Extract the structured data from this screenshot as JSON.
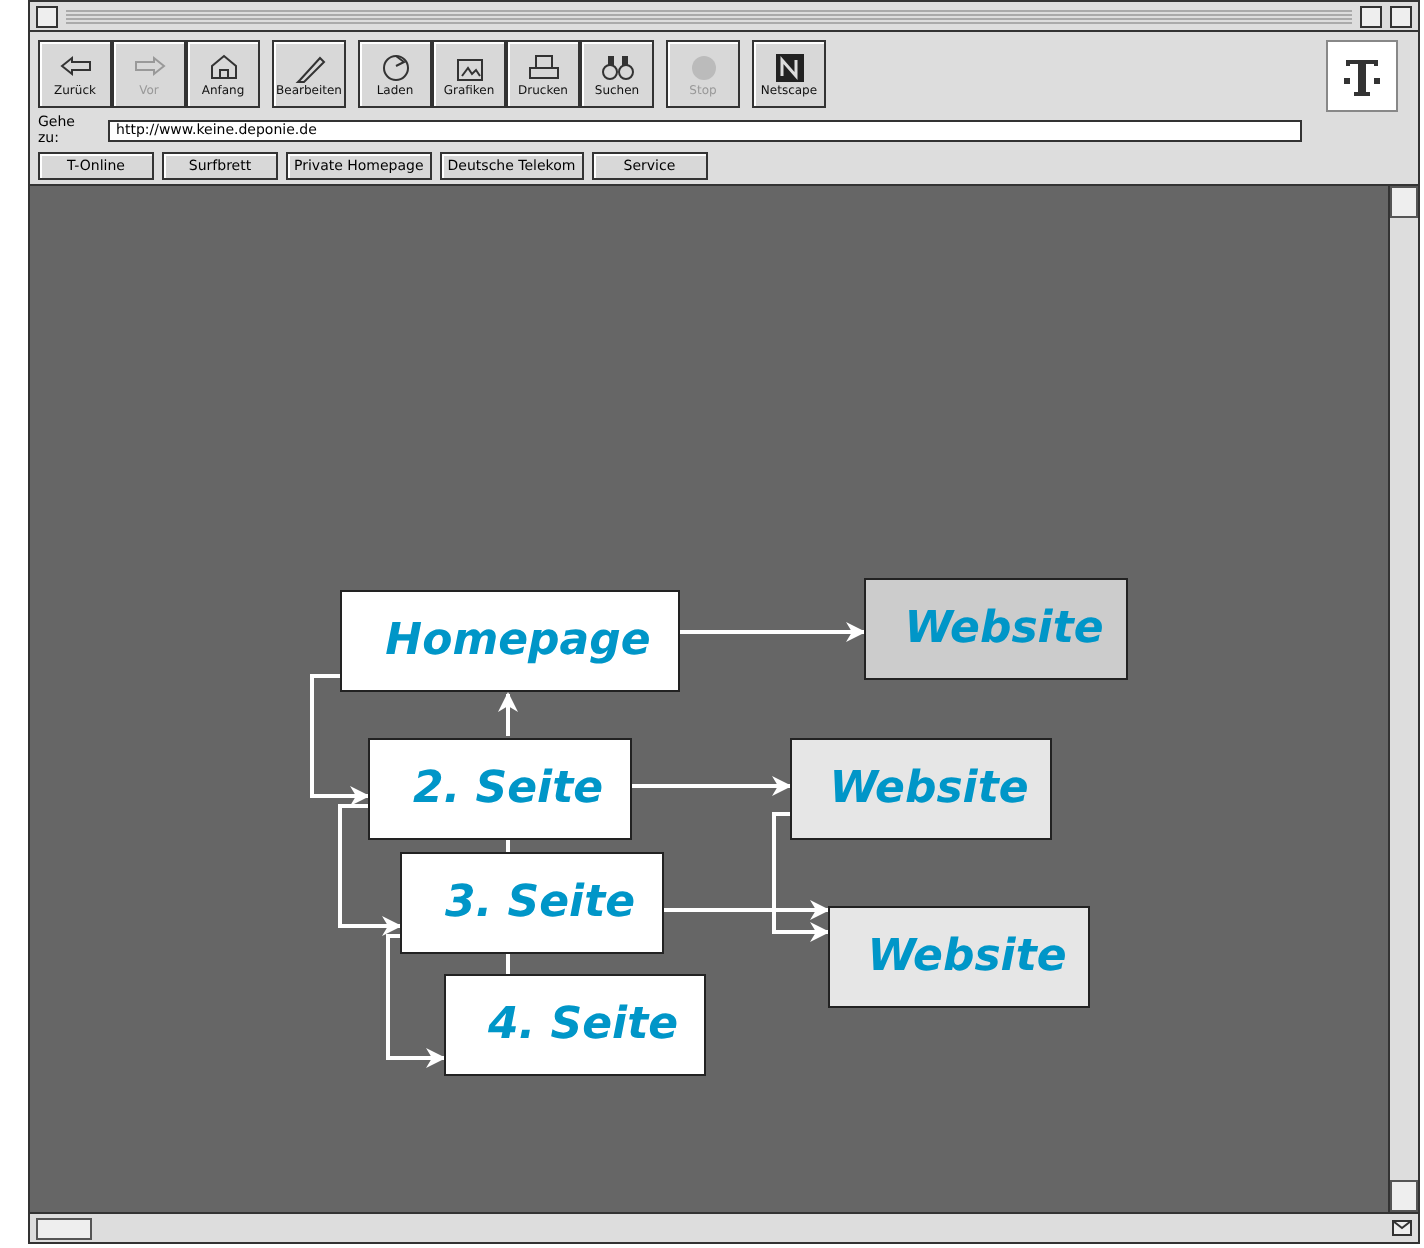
{
  "toolbar": {
    "groups": [
      [
        {
          "label": "Zurück",
          "disabled": false
        },
        {
          "label": "Vor",
          "disabled": true
        },
        {
          "label": "Anfang",
          "disabled": false
        }
      ],
      [
        {
          "label": "Bearbeiten",
          "disabled": false
        }
      ],
      [
        {
          "label": "Laden",
          "disabled": false
        },
        {
          "label": "Grafiken",
          "disabled": false
        },
        {
          "label": "Drucken",
          "disabled": false
        },
        {
          "label": "Suchen",
          "disabled": false
        }
      ],
      [
        {
          "label": "Stop",
          "disabled": true
        }
      ],
      [
        {
          "label": "Netscape",
          "disabled": false
        }
      ]
    ]
  },
  "location": {
    "label": "Gehe zu:",
    "value": "http://www.keine.deponie.de"
  },
  "directory_buttons": [
    "T-Online",
    "Surfbrett",
    "Private Homepage",
    "Deutsche Telekom",
    "Service"
  ],
  "diagram": {
    "nodes": [
      {
        "label": "Homepage",
        "kind": "page"
      },
      {
        "label": "Website",
        "kind": "website",
        "color": "#cccccc"
      },
      {
        "label": "2. Seite",
        "kind": "page"
      },
      {
        "label": "Website",
        "kind": "website",
        "color": "#e6e6e6"
      },
      {
        "label": "3. Seite",
        "kind": "page"
      },
      {
        "label": "Website",
        "kind": "website",
        "color": "#e6e6e6"
      },
      {
        "label": "4. Seite",
        "kind": "page"
      }
    ]
  }
}
